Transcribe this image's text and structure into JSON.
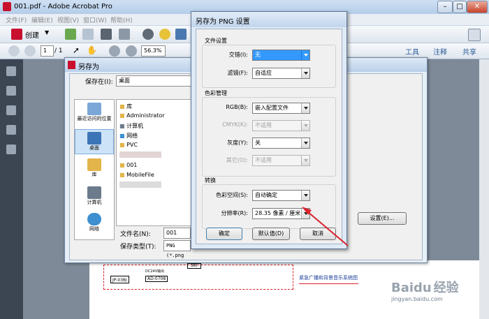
{
  "app": {
    "title": "001.pdf - Adobe Acrobat Pro",
    "menu": [
      "文件(F)",
      "编辑(E)",
      "视图(V)",
      "窗口(W)",
      "帮助(H)"
    ],
    "create_label": "创建",
    "page_current": "1",
    "page_total": "/ 1",
    "zoom": "56.3%",
    "right_links": [
      "工具",
      "注释",
      "共享"
    ]
  },
  "saveas": {
    "title": "另存为",
    "save_in_label": "保存在(I):",
    "save_in_value": "桌面",
    "places": [
      "最近访问的位置",
      "桌面",
      "库",
      "计算机",
      "网络"
    ],
    "files": [
      "库",
      "Administrator",
      "计算机",
      "网络",
      "PVC",
      "",
      "001",
      "MobileFile",
      ""
    ],
    "filename_label": "文件名(N):",
    "filename_value": "001",
    "filetype_label": "保存类型(T):",
    "filetype_value": "PNG (*.png",
    "settings_button": "设置(E)..."
  },
  "png": {
    "title": "另存为 PNG 设置",
    "file_settings": {
      "heading": "文件设置",
      "rows": [
        {
          "label": "交错(I):",
          "value": "无",
          "state": "highlight"
        },
        {
          "label": "滤镜(F):",
          "value": "自适应",
          "state": "normal"
        }
      ]
    },
    "color_mgmt": {
      "heading": "色彩管理",
      "rows": [
        {
          "label": "RGB(B):",
          "value": "嵌入配置文件",
          "state": "normal"
        },
        {
          "label": "CMYK(K):",
          "value": "不适用",
          "state": "disabled"
        },
        {
          "label": "灰度(Y):",
          "value": "关",
          "state": "normal"
        },
        {
          "label": "其它(O):",
          "value": "不适用",
          "state": "disabled"
        }
      ]
    },
    "conversion": {
      "heading": "转换",
      "rows": [
        {
          "label": "色彩空间(S):",
          "value": "自动确定",
          "state": "normal"
        },
        {
          "label": "分辨率(R):",
          "value": "28.35 像素 / 厘米",
          "state": "normal"
        }
      ]
    },
    "buttons": {
      "ok": "确定",
      "default": "默认值(D)",
      "cancel": "取消"
    }
  },
  "doc": {
    "code1": "JP-03标",
    "code2": "AD-0708",
    "heading_top": "DC24V输出",
    "dim_label": "360",
    "red_text": "紧急广播和背景音乐系统图"
  },
  "watermark": {
    "brand": "Baidu",
    "jingyan": "经验",
    "url": "jingyan.baidu.com"
  },
  "colors": {
    "arrow": "#d9232d",
    "highlight": "#3399ff",
    "link": "#2d5d9a"
  }
}
